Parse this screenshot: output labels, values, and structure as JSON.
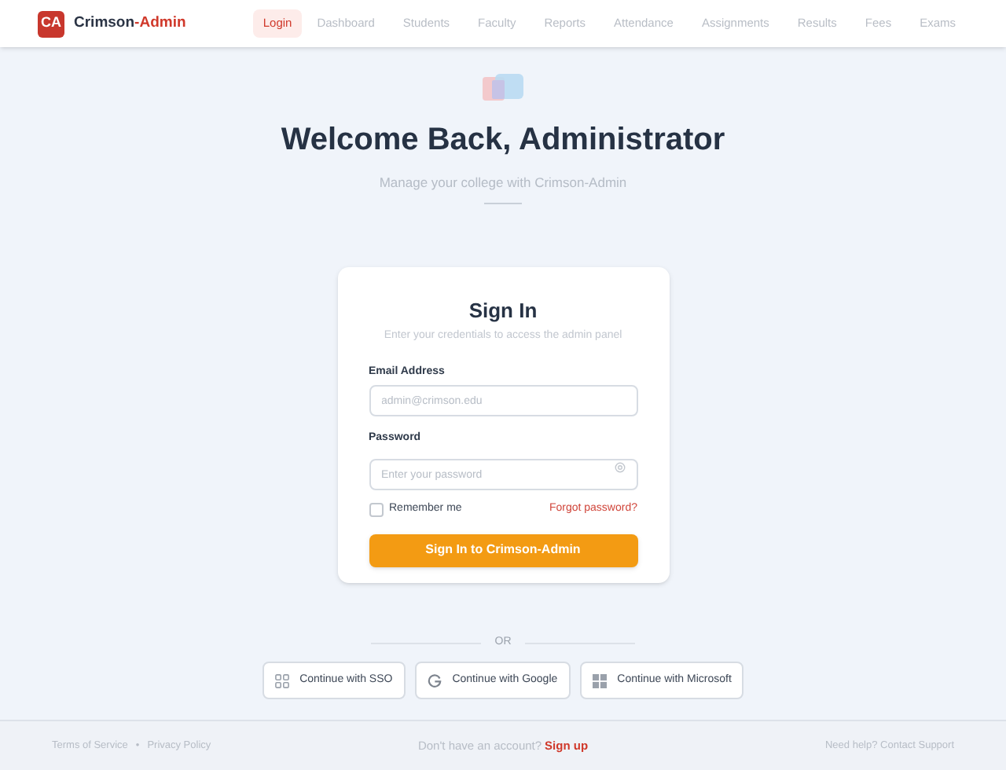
{
  "nav": {
    "logo": "CA",
    "brand": "Crimson",
    "brand_accent": "-Admin",
    "items": [
      {
        "label": "Login",
        "selected": true
      },
      {
        "label": "Dashboard",
        "selected": false
      },
      {
        "label": "Students",
        "selected": false
      },
      {
        "label": "Faculty",
        "selected": false
      },
      {
        "label": "Reports",
        "selected": false
      },
      {
        "label": "Attendance",
        "selected": false
      },
      {
        "label": "Assignments",
        "selected": false
      },
      {
        "label": "Results",
        "selected": false
      },
      {
        "label": "Fees",
        "selected": false
      },
      {
        "label": "Exams",
        "selected": false
      }
    ]
  },
  "hero": {
    "title": "Welcome Back, Administrator",
    "subtitle": "Manage your college with Crimson-Admin"
  },
  "card": {
    "title": "Sign In",
    "subtitle": "Enter your credentials to access the admin panel",
    "email": {
      "label": "Email Address",
      "placeholder": "admin@crimson.edu"
    },
    "password": {
      "label": "Password",
      "placeholder": "Enter your password"
    },
    "remember": {
      "label": "Remember me",
      "checked": false
    },
    "forgot": "Forgot password?",
    "submit": "Sign In to Crimson-Admin"
  },
  "divider": "OR",
  "social": [
    {
      "kind": "sso",
      "label": "Continue with SSO"
    },
    {
      "kind": "google",
      "label": "Continue with Google"
    },
    {
      "kind": "microsoft",
      "label": "Continue with Microsoft"
    }
  ],
  "footer": {
    "links": [
      "Terms of Service",
      "Privacy Policy"
    ],
    "separator": "•",
    "prompt": "Don't have an account?",
    "signup": "Sign up",
    "help": "Need help? Contact Support"
  }
}
